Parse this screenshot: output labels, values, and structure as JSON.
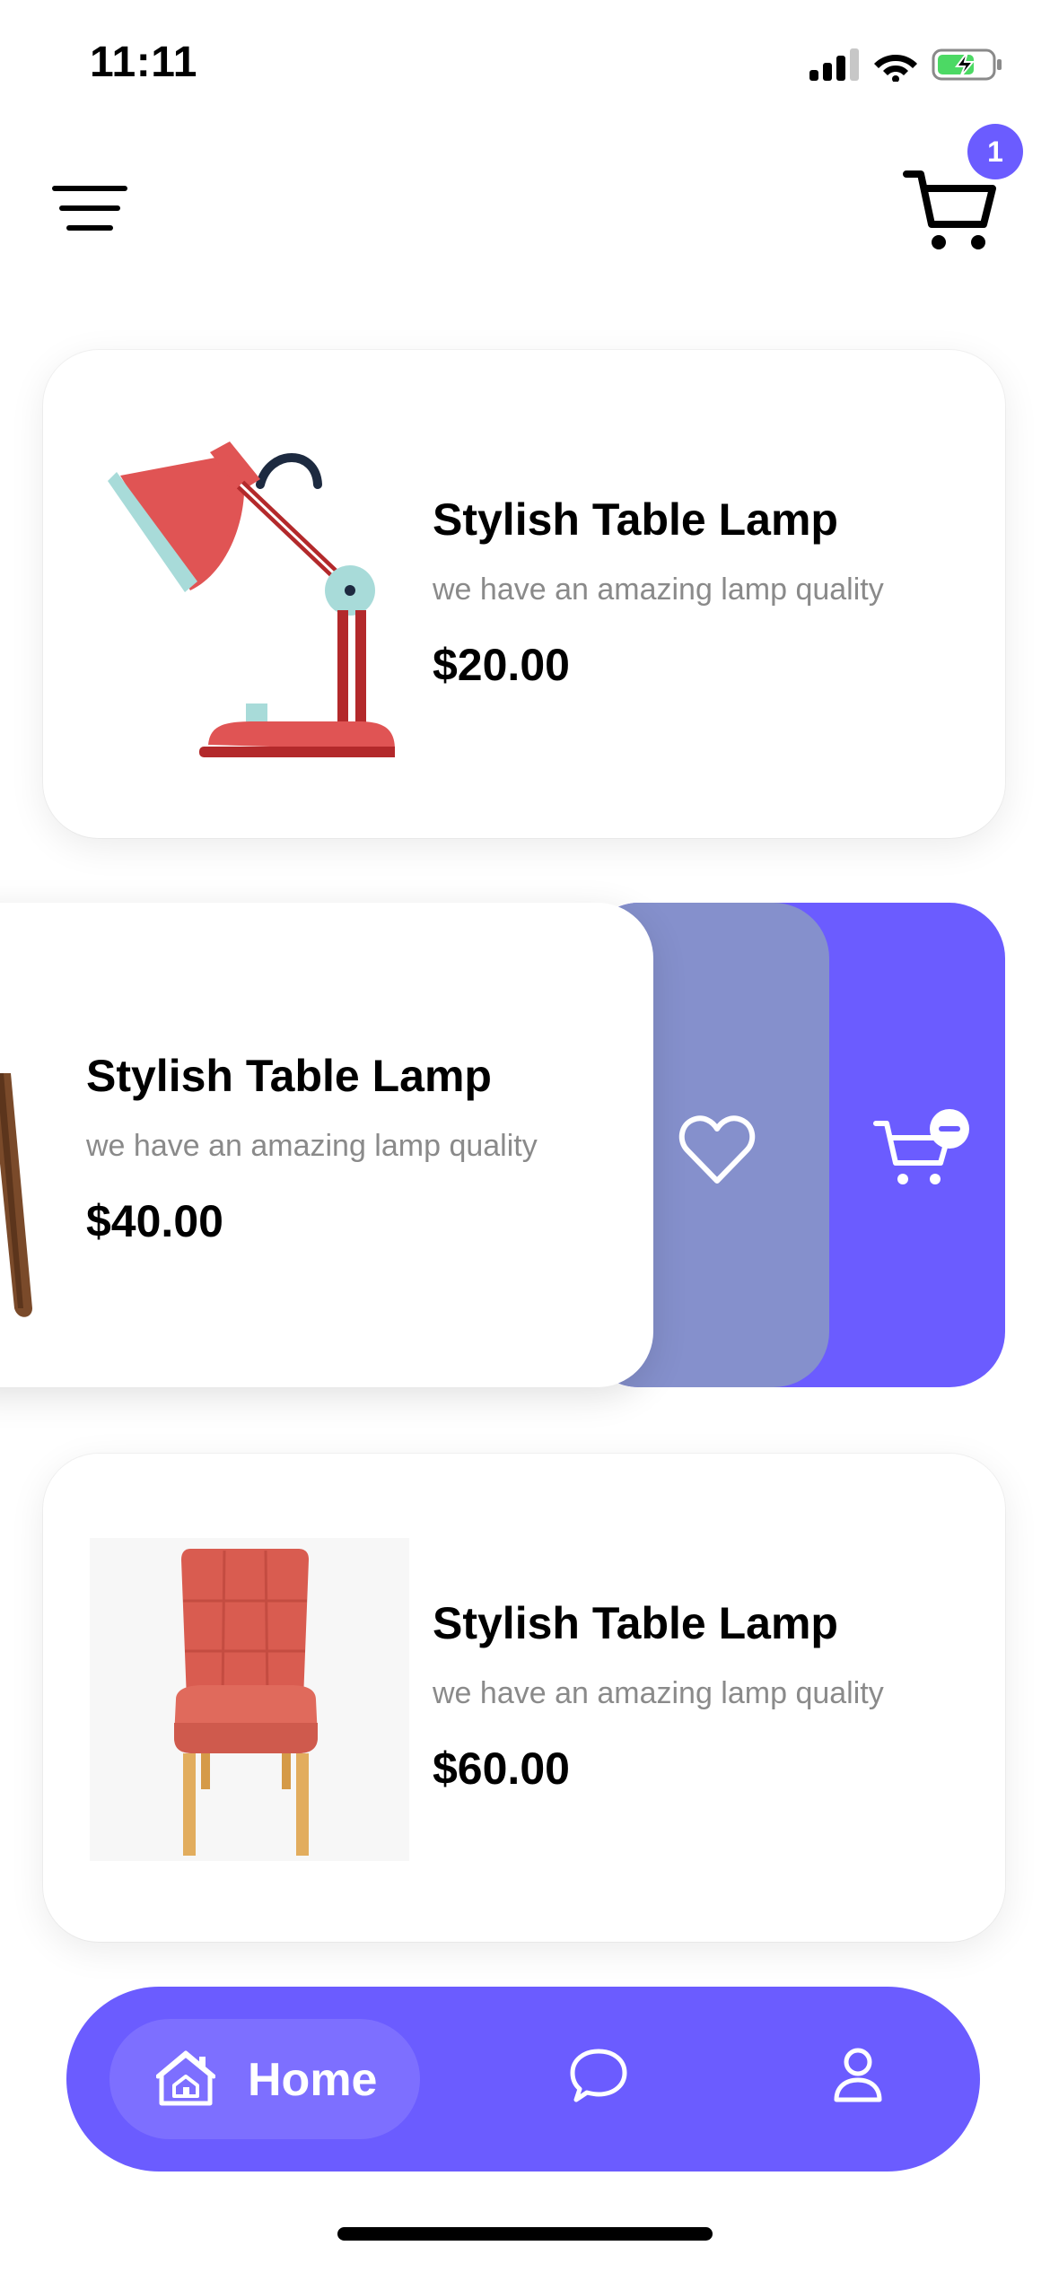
{
  "status_bar": {
    "time": "11:11"
  },
  "header": {
    "cart_count": "1"
  },
  "products": [
    {
      "title": "Stylish Table Lamp",
      "subtitle": "we have an amazing lamp quality",
      "price": "$20.00"
    },
    {
      "title": "Stylish Table Lamp",
      "subtitle": "we have an amazing lamp quality",
      "price": "$40.00"
    },
    {
      "title": "Stylish Table Lamp",
      "subtitle": "we have an amazing lamp quality",
      "price": "$60.00"
    }
  ],
  "swipe_actions": {
    "favorite_icon": "heart-icon",
    "remove_from_cart_icon": "cart-remove-icon"
  },
  "bottom_nav": {
    "home_label": "Home",
    "items": [
      "home-icon",
      "chat-icon",
      "profile-icon"
    ]
  },
  "colors": {
    "accent": "#6b5cff",
    "swipe_favorite": "#8590cc",
    "lamp_red": "#e05454",
    "lamp_dark_red": "#b3292b",
    "lamp_teal": "#a8dbd9",
    "chair_red": "#d95c50",
    "chair_legs": "#e2ad5e"
  }
}
